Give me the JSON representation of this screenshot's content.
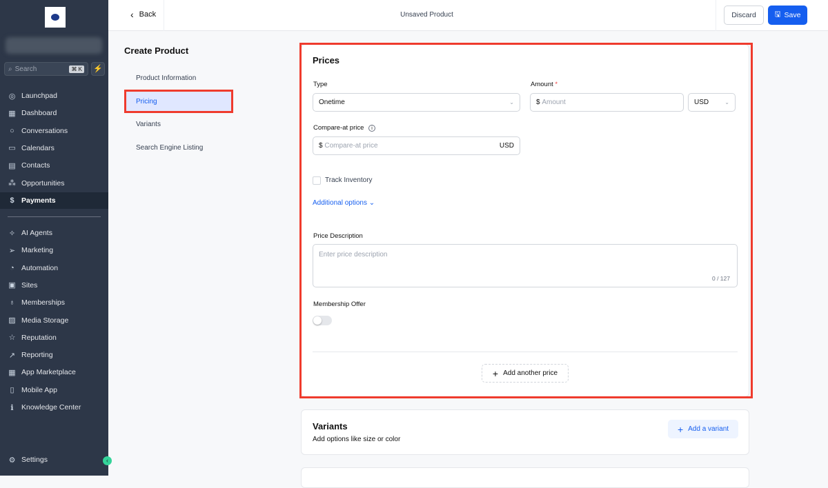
{
  "sidebar": {
    "search_placeholder": "Search",
    "shortcut": "⌘ K",
    "items": [
      {
        "label": "Launchpad",
        "icon": "◎"
      },
      {
        "label": "Dashboard",
        "icon": "▦"
      },
      {
        "label": "Conversations",
        "icon": "○"
      },
      {
        "label": "Calendars",
        "icon": "▭"
      },
      {
        "label": "Contacts",
        "icon": "▤"
      },
      {
        "label": "Opportunities",
        "icon": "⁂"
      },
      {
        "label": "Payments",
        "icon": "$"
      }
    ],
    "items2": [
      {
        "label": "AI Agents",
        "icon": "✧"
      },
      {
        "label": "Marketing",
        "icon": "➢"
      },
      {
        "label": "Automation",
        "icon": "◔"
      },
      {
        "label": "Sites",
        "icon": "▣"
      },
      {
        "label": "Memberships",
        "icon": "♁"
      },
      {
        "label": "Media Storage",
        "icon": "▨"
      },
      {
        "label": "Reputation",
        "icon": "☆"
      },
      {
        "label": "Reporting",
        "icon": "↗"
      },
      {
        "label": "App Marketplace",
        "icon": "▦"
      },
      {
        "label": "Mobile App",
        "icon": "▯"
      },
      {
        "label": "Knowledge Center",
        "icon": "ℹ"
      }
    ],
    "settings": "Settings"
  },
  "topbar": {
    "back": "Back",
    "title": "Unsaved Product",
    "discard": "Discard",
    "save": "Save"
  },
  "left": {
    "heading": "Create Product",
    "items": [
      "Product Information",
      "Pricing",
      "Variants",
      "Search Engine Listing"
    ]
  },
  "prices": {
    "title": "Prices",
    "type_label": "Type",
    "type_value": "Onetime",
    "amount_label": "Amount",
    "required": "*",
    "currency_symbol": "$",
    "amount_placeholder": "Amount",
    "currency": "USD",
    "compare_label": "Compare-at price",
    "compare_placeholder": "Compare-at price",
    "compare_currency": "USD",
    "track_inventory": "Track Inventory",
    "additional_options": "Additional options",
    "desc_label": "Price Description",
    "desc_placeholder": "Enter price description",
    "char_count": "0 / 127",
    "membership_label": "Membership Offer",
    "membership_on": false,
    "add_price": "Add another price"
  },
  "variants": {
    "title": "Variants",
    "subtitle": "Add options like size or color",
    "add": "Add a variant"
  }
}
